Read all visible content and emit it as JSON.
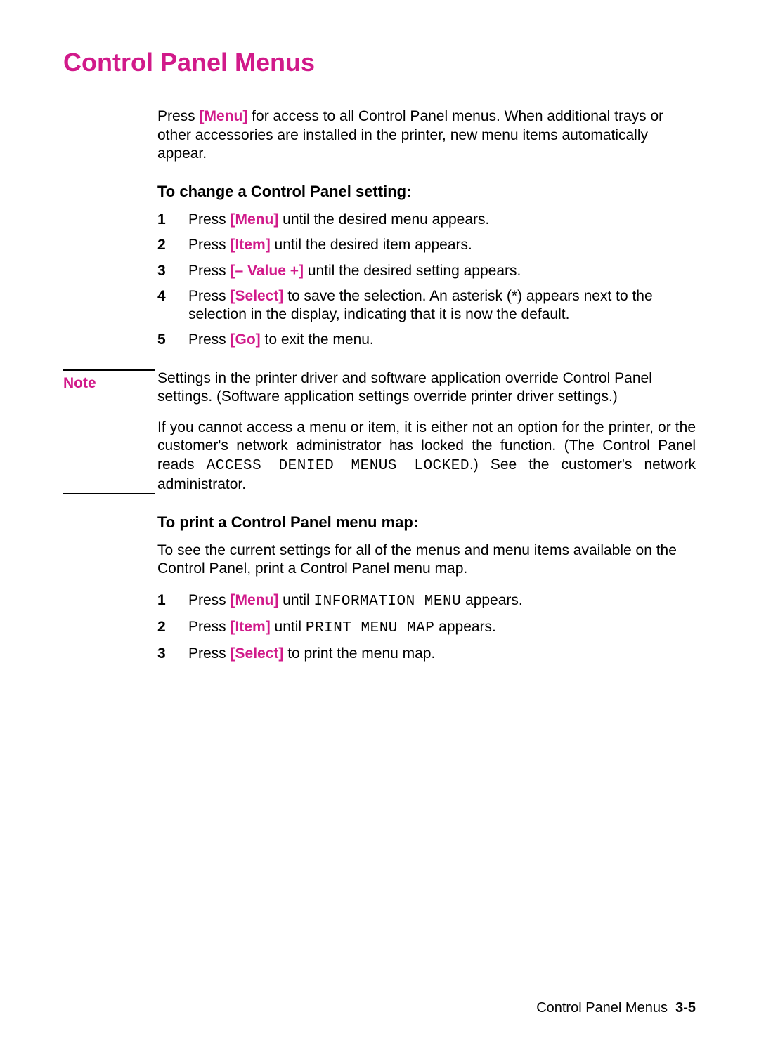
{
  "colors": {
    "accent": "#d11a8a"
  },
  "title": "Control Panel Menus",
  "intro": {
    "pre": "Press ",
    "key": "[Menu]",
    "post": " for access to all Control Panel menus. When additional trays or other accessories are installed in the printer, new menu items automatically appear."
  },
  "sec1": {
    "heading": "To change a Control Panel setting:",
    "steps": [
      {
        "n": "1",
        "pre": "Press ",
        "key": "[Menu]",
        "post": " until the desired menu appears."
      },
      {
        "n": "2",
        "pre": "Press ",
        "key": "[Item]",
        "post": " until the desired item appears."
      },
      {
        "n": "3",
        "pre": "Press ",
        "key": "[– Value +]",
        "post": " until the desired setting appears."
      },
      {
        "n": "4",
        "pre": "Press ",
        "key": "[Select]",
        "post": " to save the selection. An asterisk (*) appears next to the selection in the display, indicating that it is now the default."
      },
      {
        "n": "5",
        "pre": "Press ",
        "key": "[Go]",
        "post": " to exit the menu."
      }
    ]
  },
  "note": {
    "label": "Note",
    "p1": "Settings in the printer driver and software application override Control Panel settings. (Software application settings override printer driver settings.)",
    "p2_pre": "If you cannot access a menu or item, it is either not an option for the printer, or the customer's network administrator has locked the function. (The Control Panel reads ",
    "p2_mono": "ACCESS DENIED MENUS LOCKED",
    "p2_post": ".) See the customer's network administrator."
  },
  "sec2": {
    "heading": "To print a Control Panel menu map:",
    "intro": "To see the current settings for all of the menus and menu items available on the Control Panel, print a Control Panel menu map.",
    "steps": [
      {
        "n": "1",
        "pre": "Press ",
        "key": "[Menu]",
        "mid": " until ",
        "mono": "INFORMATION MENU",
        "post": " appears."
      },
      {
        "n": "2",
        "pre": "Press ",
        "key": "[Item]",
        "mid": " until ",
        "mono": "PRINT MENU MAP",
        "post": " appears."
      },
      {
        "n": "3",
        "pre": "Press ",
        "key": "[Select]",
        "mid": "",
        "mono": "",
        "post": " to print the menu map."
      }
    ]
  },
  "footer": {
    "text": "Control Panel Menus",
    "page": "3-5"
  }
}
